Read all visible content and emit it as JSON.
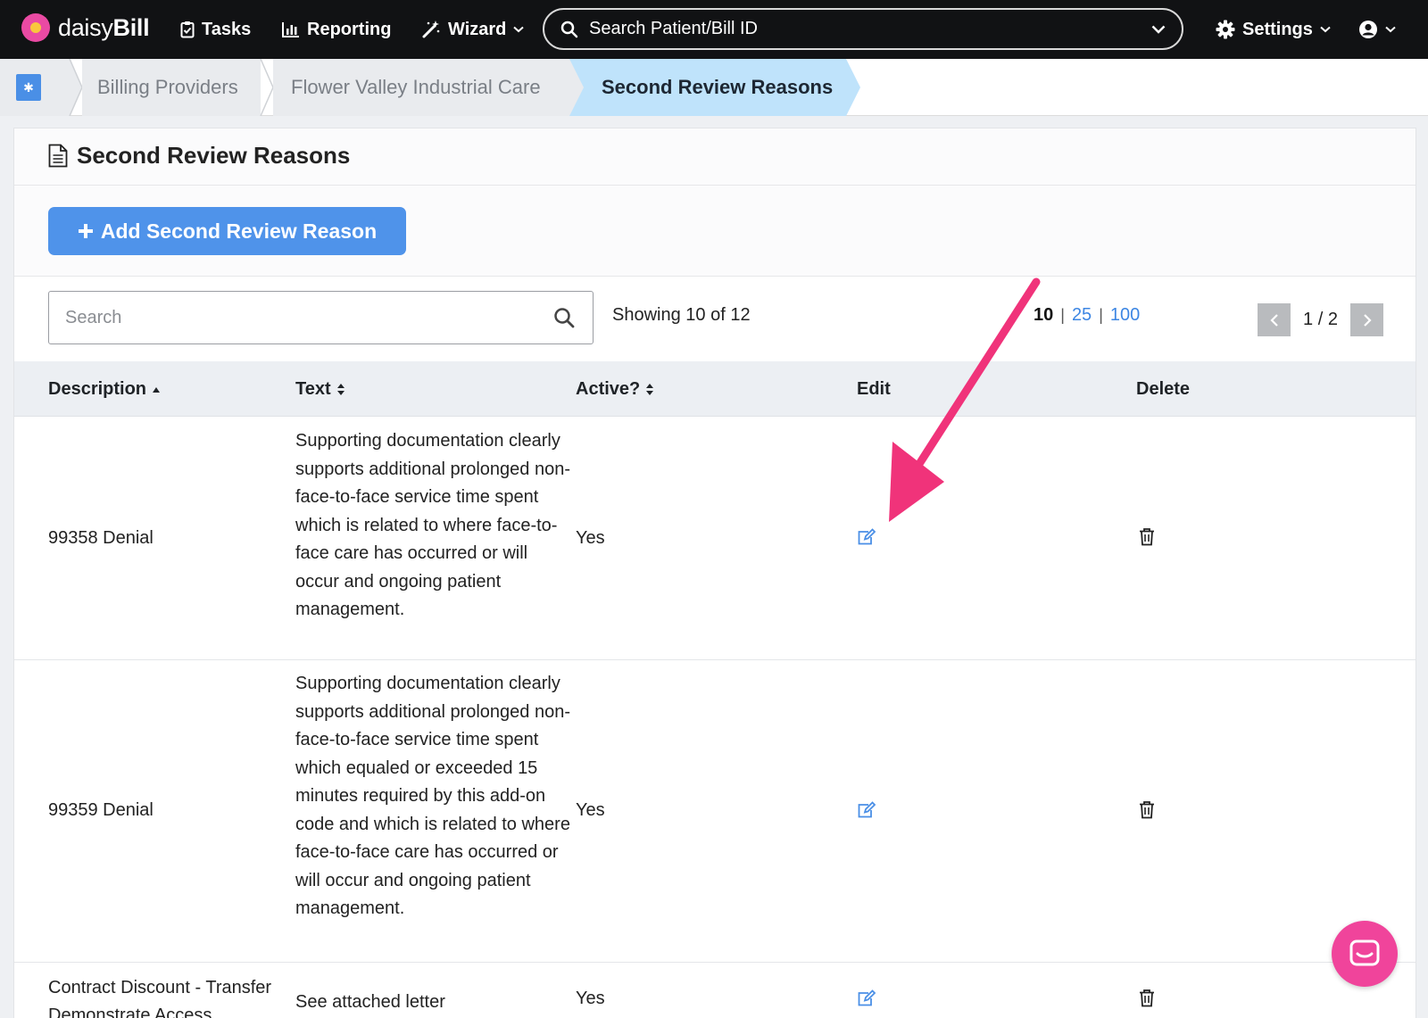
{
  "nav": {
    "logo_left": "daisy",
    "logo_right": "Bill",
    "tasks": "Tasks",
    "reporting": "Reporting",
    "wizard": "Wizard",
    "search_placeholder": "Search Patient/Bill ID",
    "settings": "Settings"
  },
  "breadcrumb": {
    "items": [
      "Billing Providers",
      "Flower Valley Industrial Care",
      "Second Review Reasons"
    ]
  },
  "page": {
    "title": "Second Review Reasons",
    "add_button": "Add Second Review Reason",
    "search_placeholder": "Search",
    "showing": "Showing 10 of 12",
    "per_page": {
      "selected": "10",
      "options": [
        "25",
        "100"
      ]
    },
    "pager": "1 / 2"
  },
  "table": {
    "headers": {
      "description": "Description",
      "text": "Text",
      "active": "Active?",
      "edit": "Edit",
      "delete": "Delete"
    },
    "rows": [
      {
        "description": "99358 Denial",
        "text": "Supporting documentation clearly supports additional prolonged non-face-to-face service time spent which is related to where face-to-face care has occurred or will occur and ongoing patient management.",
        "active": "Yes"
      },
      {
        "description": "99359 Denial",
        "text": "Supporting documentation clearly supports additional prolonged non-face-to-face service time spent which equaled or exceeded 15 minutes required by this add-on code and which is related to where face-to-face care has occurred or will occur and ongoing patient management.",
        "active": "Yes"
      },
      {
        "description": "Contract Discount - Transfer Demonstrate Access",
        "text": "See attached letter",
        "active": "Yes"
      }
    ]
  },
  "colors": {
    "nav_bg": "#111214",
    "accent_blue": "#4f93ea",
    "link_blue": "#3d86e3",
    "crumb_active": "#bfe3fb",
    "annotation_arrow": "#f0337a",
    "chat": "#f0449b"
  },
  "icons": {
    "edit": "edit-icon",
    "delete": "trash-icon",
    "chat": "chat-icon"
  }
}
